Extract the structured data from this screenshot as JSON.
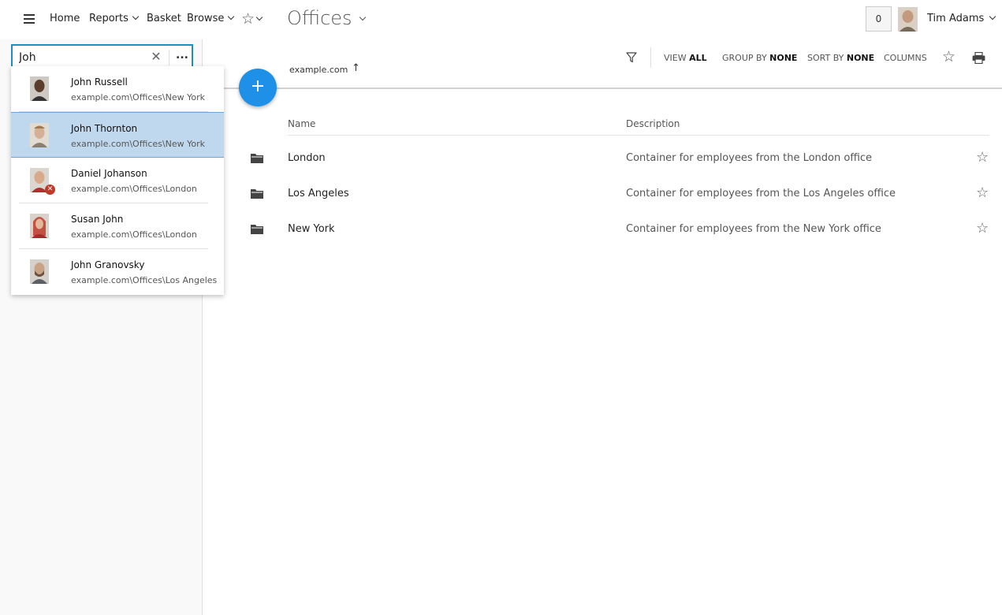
{
  "nav": {
    "home": "Home",
    "reports": "Reports",
    "basket": "Basket",
    "browse": "Browse",
    "favorites_icon": "star-icon"
  },
  "page": {
    "title": "Offices"
  },
  "user": {
    "basket_count": "0",
    "name": "Tim Adams"
  },
  "search": {
    "value": "Joh",
    "clear_icon": "close-icon",
    "more_label": "..."
  },
  "dropdown": {
    "items": [
      {
        "name": "John Russell",
        "path": "example.com\\Offices\\New York",
        "selected": false,
        "status": ""
      },
      {
        "name": "John Thornton",
        "path": "example.com\\Offices\\New York",
        "selected": true,
        "status": ""
      },
      {
        "name": "Daniel Johanson",
        "path": "example.com\\Offices\\London",
        "selected": false,
        "status": "disabled"
      },
      {
        "name": "Susan John",
        "path": "example.com\\Offices\\London",
        "selected": false,
        "status": ""
      },
      {
        "name": "John Granovsky",
        "path": "example.com\\Offices\\Los Angeles",
        "selected": false,
        "status": ""
      }
    ]
  },
  "fab": {
    "label": "+"
  },
  "toolbar": {
    "breadcrumb": "example.com",
    "up_icon": "arrow-up-icon",
    "view_prefix": "VIEW",
    "view_value": "ALL",
    "group_prefix": "GROUP BY",
    "group_value": "NONE",
    "sort_prefix": "SORT BY",
    "sort_value": "NONE",
    "columns": "COLUMNS"
  },
  "table": {
    "headers": {
      "name": "Name",
      "description": "Description"
    },
    "rows": [
      {
        "name": "London",
        "description": "Container for employees from the London office"
      },
      {
        "name": "Los Angeles",
        "description": "Container for employees from the Los Angeles office"
      },
      {
        "name": "New York",
        "description": "Container for employees from the New York office"
      }
    ]
  },
  "colors": {
    "accent": "#1f8dc0",
    "fab": "#1e90e8",
    "selected_row": "#c0d8ee",
    "status_error": "#c0392b"
  }
}
